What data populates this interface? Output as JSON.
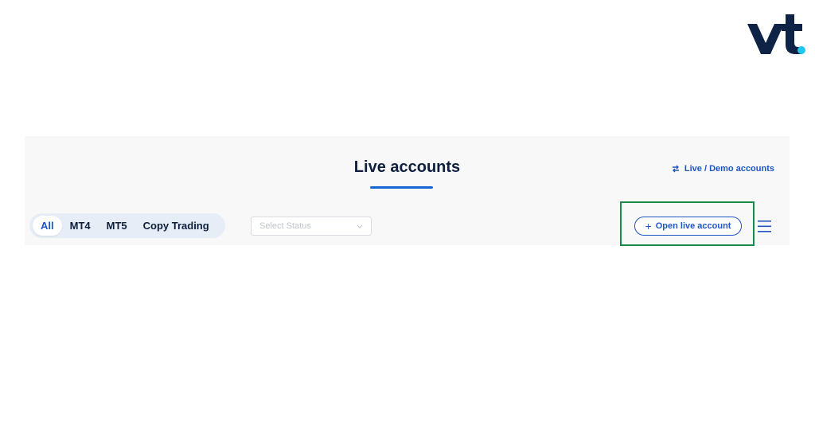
{
  "brand": {
    "logo_text": "vt",
    "colors": {
      "navy": "#0f2347",
      "cyan": "#1fc8ef",
      "accent": "#1e56c6",
      "highlight": "#178a4a"
    }
  },
  "header": {
    "title": "Live accounts",
    "switch_link": {
      "icon": "swap-arrows-icon",
      "label": "Live / Demo accounts"
    }
  },
  "filters": {
    "tabs": [
      {
        "label": "All",
        "active": true
      },
      {
        "label": "MT4",
        "active": false
      },
      {
        "label": "MT5",
        "active": false
      },
      {
        "label": "Copy Trading",
        "active": false
      }
    ],
    "status_select": {
      "placeholder": "Select Status",
      "icon": "chevron-down-icon"
    }
  },
  "actions": {
    "open_account": {
      "icon": "plus-icon",
      "plus_glyph": "+",
      "label": "Open live account"
    },
    "menu": {
      "icon": "hamburger-menu-icon"
    }
  }
}
